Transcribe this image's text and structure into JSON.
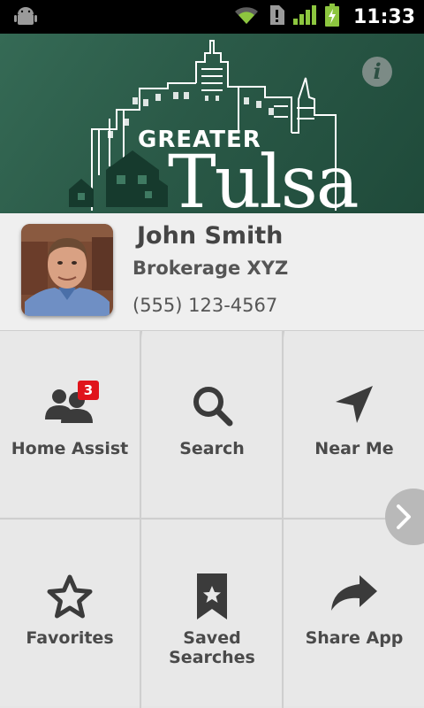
{
  "status_bar": {
    "time": "11:33",
    "icons": [
      "android-icon",
      "wifi-icon",
      "sim-alert-icon",
      "signal-icon",
      "battery-charging-icon"
    ]
  },
  "header": {
    "logo_top": "GREATER",
    "logo_main": "Tulsa",
    "info_label": "i"
  },
  "agent": {
    "name": "John Smith",
    "brokerage": "Brokerage XYZ",
    "phone": "(555) 123-4567"
  },
  "menu": {
    "home_assist": {
      "label": "Home Assist",
      "badge": "3"
    },
    "search": {
      "label": "Search"
    },
    "near_me": {
      "label": "Near Me"
    },
    "favorites": {
      "label": "Favorites"
    },
    "saved_searches": {
      "label": "Saved Searches"
    },
    "share_app": {
      "label": "Share App"
    }
  },
  "colors": {
    "banner": "#2a5947",
    "badge": "#e0141b",
    "icon": "#3b3b3b"
  }
}
